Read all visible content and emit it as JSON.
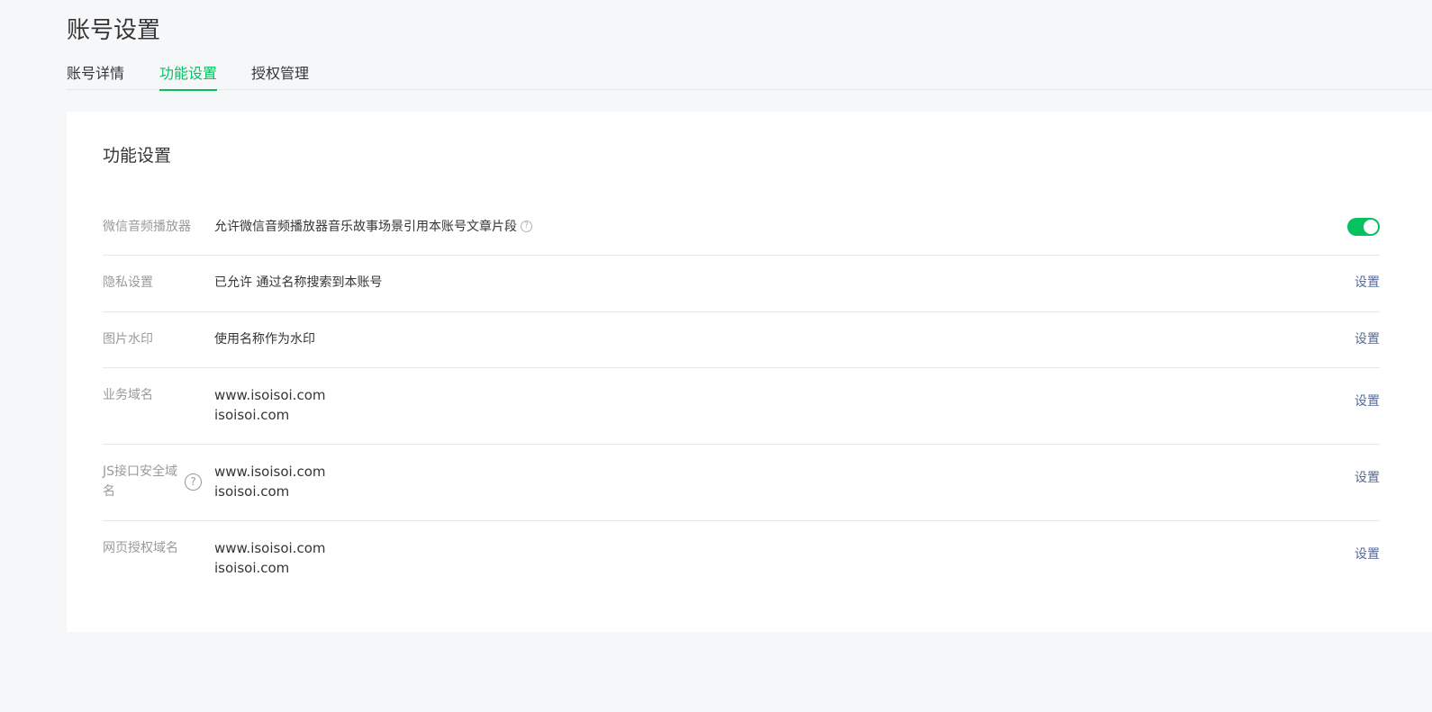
{
  "page": {
    "title": "账号设置"
  },
  "tabs": [
    {
      "label": "账号详情",
      "active": false
    },
    {
      "label": "功能设置",
      "active": true
    },
    {
      "label": "授权管理",
      "active": false
    }
  ],
  "card": {
    "title": "功能设置",
    "rows": {
      "audio_player": {
        "label": "微信音频播放器",
        "value": "允许微信音频播放器音乐故事场景引用本账号文章片段",
        "help_icon": "?",
        "toggle_on": true
      },
      "privacy": {
        "label": "隐私设置",
        "value": "已允许 通过名称搜索到本账号",
        "action": "设置"
      },
      "watermark": {
        "label": "图片水印",
        "value": "使用名称作为水印",
        "action": "设置"
      },
      "business_domain": {
        "label": "业务域名",
        "domains": [
          "www.isoisoi.com",
          "isoisoi.com"
        ],
        "action": "设置"
      },
      "js_domain": {
        "label_line1": "JS接口安全域",
        "label_line2": "名",
        "help_icon": "?",
        "domains": [
          "www.isoisoi.com",
          "isoisoi.com"
        ],
        "action": "设置"
      },
      "oauth_domain": {
        "label": "网页授权域名",
        "domains": [
          "www.isoisoi.com",
          "isoisoi.com"
        ],
        "action": "设置"
      }
    }
  },
  "colors": {
    "accent": "#07c160",
    "link": "#576b95",
    "label": "#9a9a9a",
    "background": "#f6f7f9"
  }
}
